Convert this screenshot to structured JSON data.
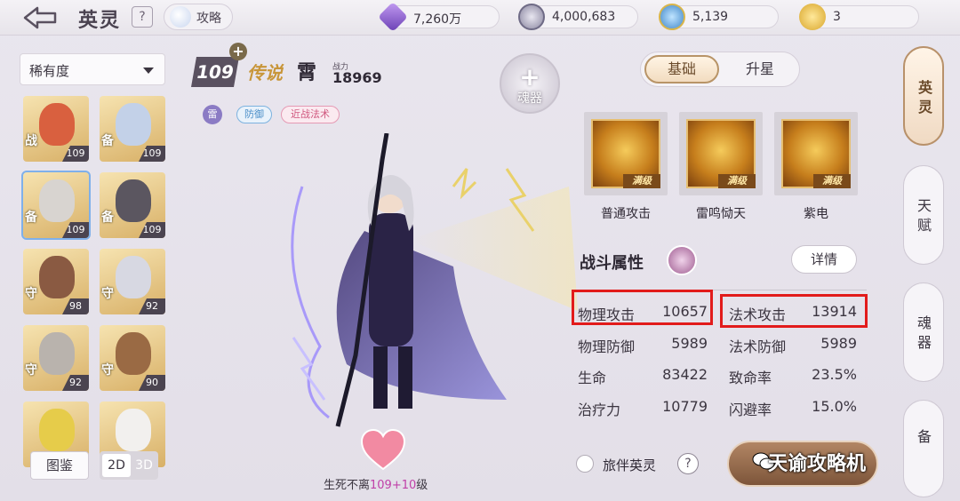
{
  "header": {
    "title": "英灵",
    "help": "?",
    "guide_label": "攻略",
    "resources": [
      {
        "icon": "crystal-icon",
        "value": "7,260万"
      },
      {
        "icon": "coin-icon",
        "value": "4,000,683"
      },
      {
        "icon": "gem-icon",
        "value": "5,139"
      },
      {
        "icon": "medal-icon",
        "value": "3"
      }
    ]
  },
  "roster": {
    "filter_label": "稀有度",
    "cards": [
      {
        "role": "战",
        "level": "109",
        "color": "#d9603f"
      },
      {
        "role": "备",
        "level": "109",
        "color": "#c3d1e8"
      },
      {
        "role": "备",
        "level": "109",
        "color": "#d8d4d0"
      },
      {
        "role": "备",
        "level": "109",
        "color": "#5b5660"
      },
      {
        "role": "守",
        "level": "98",
        "color": "#8a5a42"
      },
      {
        "role": "守",
        "level": "92",
        "color": "#d7d8e2"
      },
      {
        "role": "守",
        "level": "92",
        "color": "#b9b3ad"
      },
      {
        "role": "守",
        "level": "90",
        "color": "#9a6a44"
      },
      {
        "role": "",
        "level": "",
        "color": "#e6cc4a"
      },
      {
        "role": "",
        "level": "",
        "color": "#f2f0ee"
      }
    ],
    "gallery_label": "图鉴",
    "mode_2d": "2D",
    "mode_3d": "3D"
  },
  "hero": {
    "level": "109",
    "plus": "+",
    "rarity": "传说",
    "name": "霄",
    "cp_label": "战力",
    "cp_value": "18969",
    "element": "雷",
    "tags": [
      "防御",
      "近战法术"
    ],
    "soul_plus": "+",
    "soul_label": "魂器",
    "bond_text": "生死不离",
    "bond_level": "109+10",
    "bond_suffix": "级"
  },
  "tabs": {
    "basic": "基础",
    "star": "升星"
  },
  "skills": [
    {
      "name": "普通攻击",
      "max": "满级"
    },
    {
      "name": "雷鸣恸天",
      "max": "满级"
    },
    {
      "name": "紫电",
      "max": "满级"
    }
  ],
  "stats": {
    "title": "战斗属性",
    "detail": "详情",
    "rows": [
      {
        "left_label": "物理攻击",
        "left_value": "10657",
        "right_label": "法术攻击",
        "right_value": "13914"
      },
      {
        "left_label": "物理防御",
        "left_value": "5989",
        "right_label": "法术防御",
        "right_value": "5989"
      },
      {
        "left_label": "生命",
        "left_value": "83422",
        "right_label": "致命率",
        "right_value": "23.5%"
      },
      {
        "left_label": "治疗力",
        "left_value": "10779",
        "right_label": "闪避率",
        "right_value": "15.0%"
      }
    ]
  },
  "footer": {
    "companion_label": "旅伴英灵",
    "help": "?",
    "watermark": "天谕攻略机"
  },
  "side_tabs": [
    "英灵",
    "天赋",
    "魂器",
    "备"
  ],
  "colors": {
    "highlight": "#e21b1b",
    "accent_gold": "#c8963a",
    "bond_level": "#c040a8"
  }
}
